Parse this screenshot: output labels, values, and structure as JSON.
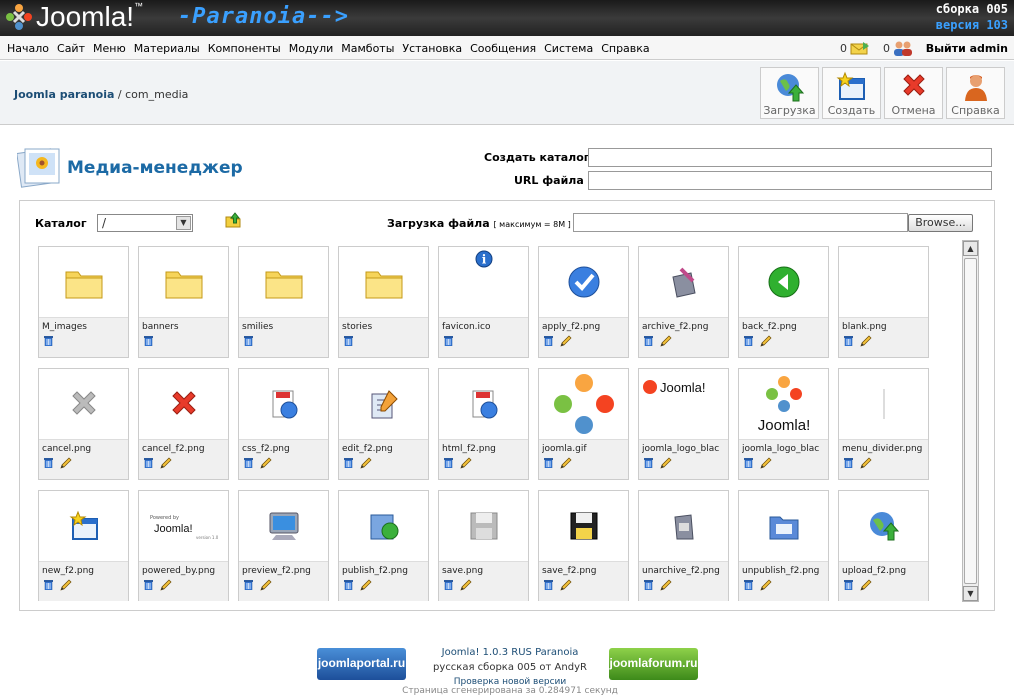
{
  "header": {
    "logo_text": "Joomla!",
    "logo_tm": "™",
    "tagline": "-Paranoia-->",
    "build_line1": "сборка 005",
    "build_line2": "версия 103"
  },
  "menu": [
    "Начало",
    "Сайт",
    "Меню",
    "Материалы",
    "Компоненты",
    "Модули",
    "Мамботы",
    "Установка",
    "Сообщения",
    "Система",
    "Справка"
  ],
  "counters": {
    "messages": "0",
    "users": "0"
  },
  "logout_label": "Выйти admin",
  "breadcrumb": {
    "site": "Joomla paranoia",
    "separator": " / ",
    "component": "com_media"
  },
  "toolbar": {
    "upload": "Загрузка",
    "create": "Создать",
    "cancel": "Отмена",
    "help": "Справка"
  },
  "page_title": "Медиа-менеджер",
  "form": {
    "create_dir_label": "Создать каталог",
    "create_dir_value": "",
    "url_label": "URL файла",
    "url_value": "",
    "catalog_label": "Каталог",
    "catalog_value": "/",
    "upload_label": "Загрузка файла",
    "upload_note": "[ максимум = 8M ]",
    "browse_label": "Browse..."
  },
  "files": [
    {
      "name": "M_images",
      "icon": "folder",
      "editable": false
    },
    {
      "name": "banners",
      "icon": "folder",
      "editable": false
    },
    {
      "name": "smilies",
      "icon": "folder",
      "editable": false
    },
    {
      "name": "stories",
      "icon": "folder",
      "editable": false
    },
    {
      "name": "favicon.ico",
      "icon": "info",
      "editable": false
    },
    {
      "name": "apply_f2.png",
      "icon": "apply",
      "editable": true
    },
    {
      "name": "archive_f2.png",
      "icon": "archive",
      "editable": true
    },
    {
      "name": "back_f2.png",
      "icon": "back",
      "editable": true
    },
    {
      "name": "blank.png",
      "icon": "blank",
      "editable": true
    },
    {
      "name": "cancel.png",
      "icon": "cancel-gray",
      "editable": true
    },
    {
      "name": "cancel_f2.png",
      "icon": "cancel-red",
      "editable": true
    },
    {
      "name": "css_f2.png",
      "icon": "css",
      "editable": true
    },
    {
      "name": "edit_f2.png",
      "icon": "edit",
      "editable": true
    },
    {
      "name": "html_f2.png",
      "icon": "html",
      "editable": true
    },
    {
      "name": "joomla.gif",
      "icon": "joomla-big",
      "editable": true
    },
    {
      "name": "joomla_logo_blac",
      "icon": "joomla-wide",
      "editable": true
    },
    {
      "name": "joomla_logo_blac",
      "icon": "joomla-stack",
      "editable": true
    },
    {
      "name": "menu_divider.png",
      "icon": "divider",
      "editable": true
    },
    {
      "name": "new_f2.png",
      "icon": "new",
      "editable": true
    },
    {
      "name": "powered_by.png",
      "icon": "powered",
      "editable": true
    },
    {
      "name": "preview_f2.png",
      "icon": "preview",
      "editable": true
    },
    {
      "name": "publish_f2.png",
      "icon": "publish",
      "editable": true
    },
    {
      "name": "save.png",
      "icon": "save-gray",
      "editable": true
    },
    {
      "name": "save_f2.png",
      "icon": "save",
      "editable": true
    },
    {
      "name": "unarchive_f2.png",
      "icon": "unarchive",
      "editable": true
    },
    {
      "name": "unpublish_f2.png",
      "icon": "unpublish",
      "editable": true
    },
    {
      "name": "upload_f2.png",
      "icon": "upload",
      "editable": true
    }
  ],
  "footer": {
    "badge_left": "joomlaportal.ru",
    "badge_right": "joomlaforum.ru",
    "line1": "Joomla! 1.0.3 RUS Paranoia",
    "line2": "русская сборка 005 от AndyR",
    "line3": "Проверка новой версии",
    "generated": "Страница сгенерирована за 0.284971 секунд"
  }
}
